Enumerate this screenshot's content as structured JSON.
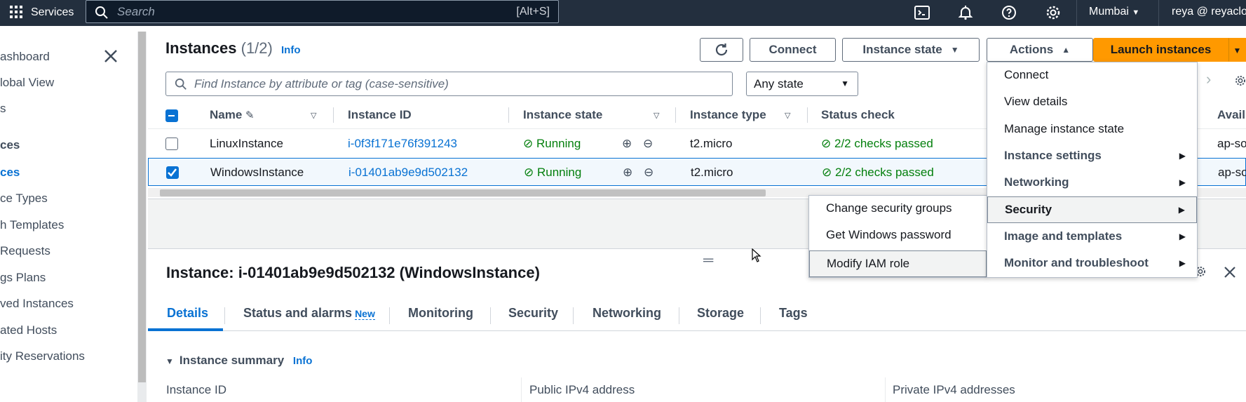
{
  "topnav": {
    "services": "Services",
    "search_placeholder": "Search",
    "search_shortcut": "[Alt+S]",
    "region": "Mumbai",
    "user": "reya @ reyaclou"
  },
  "sidebar": {
    "items": [
      {
        "label": "ashboard"
      },
      {
        "label": "lobal View"
      },
      {
        "label": "s"
      },
      {
        "label": "ces"
      },
      {
        "label": "ces"
      },
      {
        "label": "ce Types"
      },
      {
        "label": "h Templates"
      },
      {
        "label": "Requests"
      },
      {
        "label": "gs Plans"
      },
      {
        "label": "ved Instances"
      },
      {
        "label": "ated Hosts"
      },
      {
        "label": "ity Reservations"
      }
    ]
  },
  "instances": {
    "title": "Instances",
    "count": "(1/2)",
    "info": "Info",
    "buttons": {
      "connect": "Connect",
      "instance_state": "Instance state",
      "actions": "Actions",
      "launch": "Launch instances"
    },
    "find_placeholder": "Find Instance by attribute or tag (case-sensitive)",
    "state_filter": "Any state",
    "columns": [
      "Name",
      "Instance ID",
      "Instance state",
      "Instance type",
      "Status check",
      "Avail"
    ],
    "rows": [
      {
        "name": "LinuxInstance",
        "id": "i-0f3f171e76f391243",
        "state": "Running",
        "type": "t2.micro",
        "status": "2/2 checks passed",
        "az": "ap-so"
      },
      {
        "name": "WindowsInstance",
        "id": "i-01401ab9e9d502132",
        "state": "Running",
        "type": "t2.micro",
        "status": "2/2 checks passed",
        "az": "ap-so"
      }
    ]
  },
  "actions_menu": {
    "items": [
      {
        "label": "Connect"
      },
      {
        "label": "View details"
      },
      {
        "label": "Manage instance state"
      },
      {
        "label": "Instance settings"
      },
      {
        "label": "Networking"
      },
      {
        "label": "Security"
      },
      {
        "label": "Image and templates"
      },
      {
        "label": "Monitor and troubleshoot"
      }
    ]
  },
  "security_submenu": {
    "items": [
      {
        "label": "Change security groups"
      },
      {
        "label": "Get Windows password"
      },
      {
        "label": "Modify IAM role"
      }
    ]
  },
  "details": {
    "title": "Instance: i-01401ab9e9d502132 (WindowsInstance)",
    "tabs": [
      "Details",
      "Status and alarms",
      "Monitoring",
      "Security",
      "Networking",
      "Storage",
      "Tags"
    ],
    "new_badge": "New",
    "summary": "Instance summary",
    "summary_info": "Info",
    "fields": [
      "Instance ID",
      "Public IPv4 address",
      "Private IPv4 addresses"
    ]
  },
  "colors": {
    "nav_bg": "#232f3e",
    "link": "#0972d3",
    "success": "#037f0c",
    "primary_button": "#ff9900"
  }
}
